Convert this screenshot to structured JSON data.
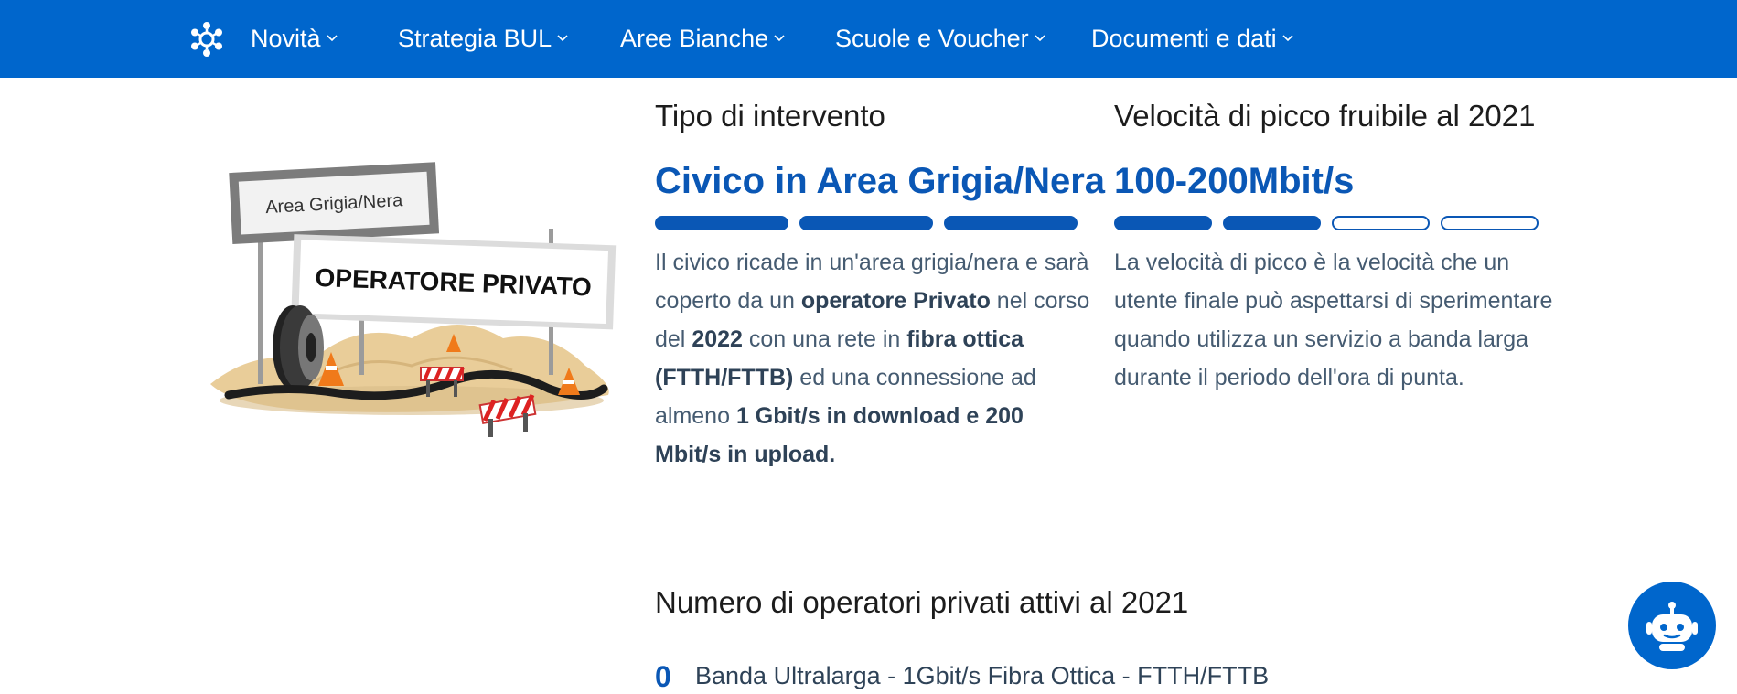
{
  "nav": {
    "logo_icon": "network-logo-icon",
    "items": [
      {
        "label": "Novità"
      },
      {
        "label": "Strategia BUL"
      },
      {
        "label": "Aree Bianche"
      },
      {
        "label": "Scuole e Voucher"
      },
      {
        "label": "Documenti e dati"
      }
    ]
  },
  "illustration": {
    "sign_top": "Area Grigia/Nera",
    "sign_main": "OPERATORE PRIVATO"
  },
  "tipo": {
    "heading": "Tipo di intervento",
    "value": "Civico in Area Grigia/Nera",
    "level": 3,
    "level_max": 3,
    "desc": {
      "t1": "Il civico ricade in un'area grigia/nera e sarà coperto da un ",
      "b1": "operatore Privato",
      "t2": " nel corso del ",
      "b2": "2022",
      "t3": " con una rete in ",
      "b3": "fibra ottica (FTTH/FTTB)",
      "t4": " ed una connessione ad almeno ",
      "b4": "1 Gbit/s in download e 200 Mbit/s in upload."
    }
  },
  "velocita": {
    "heading": "Velocità di picco fruibile al 2021",
    "value": "100-200Mbit/s",
    "level": 2,
    "level_max": 4,
    "desc": "La velocità di picco è la velocità che un utente finale può aspettarsi di sperimentare quando utilizza un servizio a banda larga durante il periodo dell'ora di punta."
  },
  "operatori": {
    "heading": "Numero di operatori privati attivi al 2021",
    "count": "0",
    "label": "Banda Ultralarga - 1Gbit/s Fibra Ottica - FTTH/FTTB"
  },
  "chatbot": {
    "icon": "robot-icon"
  },
  "colors": {
    "nav_bg": "#0066cc",
    "accent": "#0a57b5"
  }
}
